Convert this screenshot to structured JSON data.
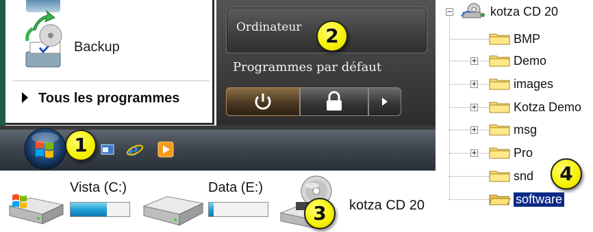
{
  "start_menu": {
    "left_items": [
      {
        "label": "Backup"
      }
    ],
    "all_programs_label": "Tous les programmes",
    "right_items": [
      {
        "label": "Ordinateur"
      },
      {
        "label": "Programmes par défaut"
      }
    ],
    "power_buttons": {
      "power_icon": "power-icon",
      "lock_icon": "lock-icon",
      "arrow_icon": "chevron-right-icon"
    }
  },
  "taskbar": {
    "start_orb_icon": "windows-logo-icon",
    "quick_launch": [
      {
        "icon": "show-desktop-icon"
      },
      {
        "icon": "internet-explorer-icon"
      },
      {
        "icon": "media-player-icon"
      }
    ]
  },
  "drives": [
    {
      "label": "Vista (C:)",
      "icon": "windows-drive-icon",
      "usage": 0.62
    },
    {
      "label": "Data (E:)",
      "icon": "hard-drive-icon",
      "usage": 0.08
    },
    {
      "label": "kotza CD 20",
      "icon": "cd-drive-icon"
    }
  ],
  "tree": {
    "root": {
      "label": "kotza CD 20",
      "expander": "−"
    },
    "children": [
      {
        "label": "BMP",
        "expander": ""
      },
      {
        "label": "Demo",
        "expander": "+"
      },
      {
        "label": "images",
        "expander": "+"
      },
      {
        "label": "Kotza Demo",
        "expander": "+"
      },
      {
        "label": "msg",
        "expander": "+"
      },
      {
        "label": "Pro",
        "expander": "+"
      },
      {
        "label": "snd",
        "expander": ""
      },
      {
        "label": "software",
        "expander": "",
        "selected": true
      }
    ]
  },
  "callouts": [
    {
      "number": "1"
    },
    {
      "number": "2"
    },
    {
      "number": "3"
    },
    {
      "number": "4"
    }
  ],
  "colors": {
    "callout_yellow": "#f6f000",
    "selection_blue": "#0a2a86",
    "taskbar_dark": "#3c434b"
  }
}
